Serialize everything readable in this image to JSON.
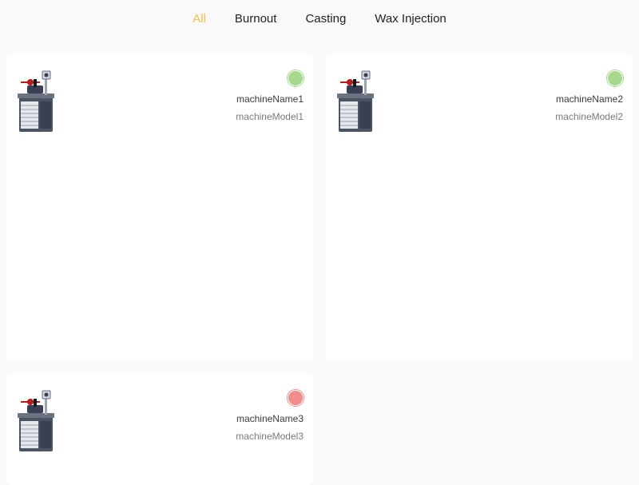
{
  "tabs": [
    {
      "label": "All",
      "active": true
    },
    {
      "label": "Burnout",
      "active": false
    },
    {
      "label": "Casting",
      "active": false
    },
    {
      "label": "Wax Injection",
      "active": false
    }
  ],
  "accent_color": "#f6c24a",
  "machines": [
    {
      "name": "machineName1",
      "model": "machineModel1",
      "status_color": "#a6d98c",
      "icon": "casting-machine-icon"
    },
    {
      "name": "machineName2",
      "model": "machineModel2",
      "status_color": "#a6d98c",
      "icon": "casting-machine-icon"
    },
    {
      "name": "machineName3",
      "model": "machineModel3",
      "status_color": "#f28c8c",
      "icon": "casting-machine-icon"
    }
  ]
}
